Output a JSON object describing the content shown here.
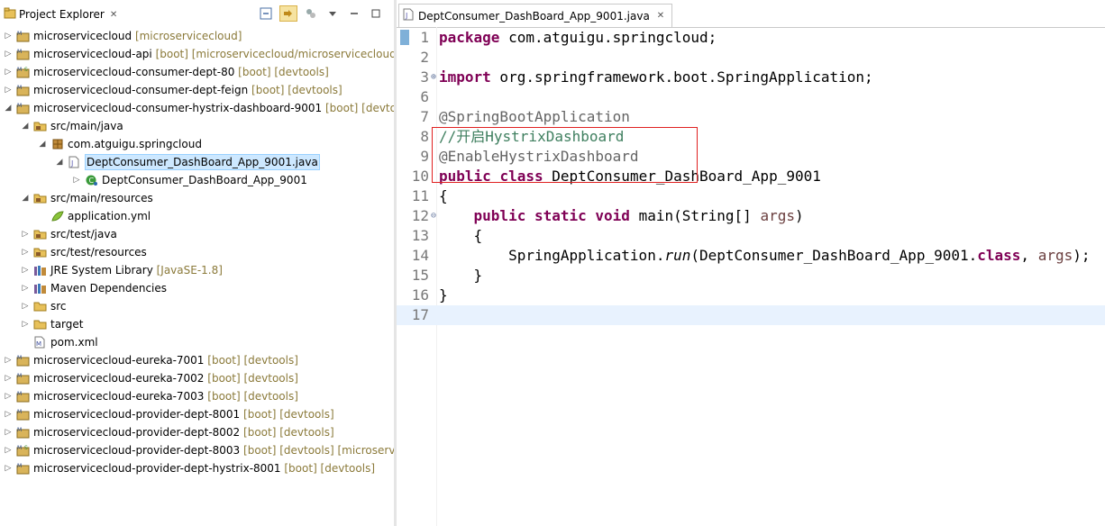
{
  "explorer": {
    "title": "Project Explorer",
    "tree": [
      {
        "label": "microservicecloud",
        "deco": " [microservicecloud]",
        "expanded": false,
        "icon": "maven-project-icon"
      },
      {
        "label": "microservicecloud-api",
        "deco": " [boot] [microservicecloud/microservicecloud-",
        "expanded": false,
        "icon": "maven-project-icon"
      },
      {
        "label": "microservicecloud-consumer-dept-80",
        "deco": " [boot] [devtools]",
        "expanded": false,
        "icon": "maven-spring-project-icon"
      },
      {
        "label": "microservicecloud-consumer-dept-feign",
        "deco": " [boot] [devtools]",
        "expanded": false,
        "icon": "maven-project-icon"
      },
      {
        "label": "microservicecloud-consumer-hystrix-dashboard-9001",
        "deco": " [boot] [devtoo",
        "expanded": true,
        "icon": "maven-project-icon"
      },
      {
        "label": "src/main/java",
        "deco": "",
        "expanded": true,
        "icon": "source-folder-icon"
      },
      {
        "label": "com.atguigu.springcloud",
        "deco": "",
        "expanded": true,
        "icon": "package-icon"
      },
      {
        "label": "DeptConsumer_DashBoard_App_9001.java",
        "deco": "",
        "expanded": true,
        "icon": "java-file-icon"
      },
      {
        "label": "DeptConsumer_DashBoard_App_9001",
        "deco": "",
        "expanded": false,
        "icon": "class-icon"
      },
      {
        "label": "src/main/resources",
        "deco": "",
        "expanded": true,
        "icon": "source-folder-icon"
      },
      {
        "label": "application.yml",
        "deco": "",
        "expanded": null,
        "icon": "yaml-file-icon"
      },
      {
        "label": "src/test/java",
        "deco": "",
        "expanded": false,
        "icon": "source-folder-icon"
      },
      {
        "label": "src/test/resources",
        "deco": "",
        "expanded": false,
        "icon": "source-folder-icon"
      },
      {
        "label": "JRE System Library",
        "deco": " [JavaSE-1.8]",
        "expanded": false,
        "icon": "library-icon"
      },
      {
        "label": "Maven Dependencies",
        "deco": "",
        "expanded": false,
        "icon": "library-icon"
      },
      {
        "label": "src",
        "deco": "",
        "expanded": false,
        "icon": "folder-icon"
      },
      {
        "label": "target",
        "deco": "",
        "expanded": false,
        "icon": "folder-icon"
      },
      {
        "label": "pom.xml",
        "deco": "",
        "expanded": null,
        "icon": "pom-file-icon"
      },
      {
        "label": "microservicecloud-eureka-7001",
        "deco": " [boot] [devtools]",
        "expanded": false,
        "icon": "maven-project-icon"
      },
      {
        "label": "microservicecloud-eureka-7002",
        "deco": " [boot] [devtools]",
        "expanded": false,
        "icon": "maven-project-icon"
      },
      {
        "label": "microservicecloud-eureka-7003",
        "deco": " [boot] [devtools]",
        "expanded": false,
        "icon": "maven-project-icon"
      },
      {
        "label": "microservicecloud-provider-dept-8001",
        "deco": " [boot] [devtools]",
        "expanded": false,
        "icon": "maven-project-icon"
      },
      {
        "label": "microservicecloud-provider-dept-8002",
        "deco": " [boot] [devtools]",
        "expanded": false,
        "icon": "maven-project-icon"
      },
      {
        "label": "microservicecloud-provider-dept-8003",
        "deco": " [boot] [devtools] [microservi",
        "expanded": false,
        "icon": "maven-spring-project-icon"
      },
      {
        "label": "microservicecloud-provider-dept-hystrix-8001",
        "deco": " [boot] [devtools]",
        "expanded": false,
        "icon": "maven-project-icon"
      }
    ]
  },
  "editor": {
    "tab_label": "DeptConsumer_DashBoard_App_9001.java",
    "lines": [
      {
        "n": "1",
        "fold": "",
        "tokens": [
          {
            "t": "package",
            "c": "kw"
          },
          {
            "t": " com.atguigu.springcloud;",
            "c": ""
          }
        ]
      },
      {
        "n": "2",
        "fold": "",
        "tokens": []
      },
      {
        "n": "3",
        "fold": "⊕",
        "tokens": [
          {
            "t": "import",
            "c": "kw"
          },
          {
            "t": " org.springframework.boot.SpringApplication;",
            "c": ""
          }
        ]
      },
      {
        "n": "6",
        "fold": "",
        "tokens": []
      },
      {
        "n": "7",
        "fold": "",
        "tokens": [
          {
            "t": "@SpringBootApplication",
            "c": "an"
          }
        ]
      },
      {
        "n": "8",
        "fold": "",
        "tokens": [
          {
            "t": "//开启HystrixDashboard",
            "c": "cm"
          }
        ]
      },
      {
        "n": "9",
        "fold": "",
        "tokens": [
          {
            "t": "@EnableHystrixDashboard",
            "c": "an"
          }
        ]
      },
      {
        "n": "10",
        "fold": "",
        "tokens": [
          {
            "t": "public",
            "c": "kw"
          },
          {
            "t": " ",
            "c": ""
          },
          {
            "t": "class",
            "c": "kw"
          },
          {
            "t": " DeptConsumer_DashBoard_App_9001",
            "c": ""
          }
        ]
      },
      {
        "n": "11",
        "fold": "",
        "tokens": [
          {
            "t": "{",
            "c": ""
          }
        ]
      },
      {
        "n": "12",
        "fold": "⊖",
        "tokens": [
          {
            "t": "    ",
            "c": ""
          },
          {
            "t": "public",
            "c": "kw"
          },
          {
            "t": " ",
            "c": ""
          },
          {
            "t": "static",
            "c": "kw"
          },
          {
            "t": " ",
            "c": ""
          },
          {
            "t": "void",
            "c": "kw"
          },
          {
            "t": " main(String[] ",
            "c": ""
          },
          {
            "t": "args",
            "c": "vr"
          },
          {
            "t": ")",
            "c": ""
          }
        ]
      },
      {
        "n": "13",
        "fold": "",
        "tokens": [
          {
            "t": "    {",
            "c": ""
          }
        ]
      },
      {
        "n": "14",
        "fold": "",
        "tokens": [
          {
            "t": "        SpringApplication.",
            "c": ""
          },
          {
            "t": "run",
            "c": "it"
          },
          {
            "t": "(DeptConsumer_DashBoard_App_9001.",
            "c": ""
          },
          {
            "t": "class",
            "c": "kw"
          },
          {
            "t": ", ",
            "c": ""
          },
          {
            "t": "args",
            "c": "vr"
          },
          {
            "t": ");",
            "c": ""
          }
        ]
      },
      {
        "n": "15",
        "fold": "",
        "tokens": [
          {
            "t": "    }",
            "c": ""
          }
        ]
      },
      {
        "n": "16",
        "fold": "",
        "tokens": [
          {
            "t": "}",
            "c": ""
          }
        ]
      },
      {
        "n": "17",
        "fold": "",
        "tokens": [],
        "current": true
      }
    ]
  },
  "colors": {
    "keyword": "#7f0055",
    "comment": "#3f7f5f",
    "annotation": "#646464",
    "highlight_box": "#e02020",
    "current_line": "#e8f2fe"
  }
}
